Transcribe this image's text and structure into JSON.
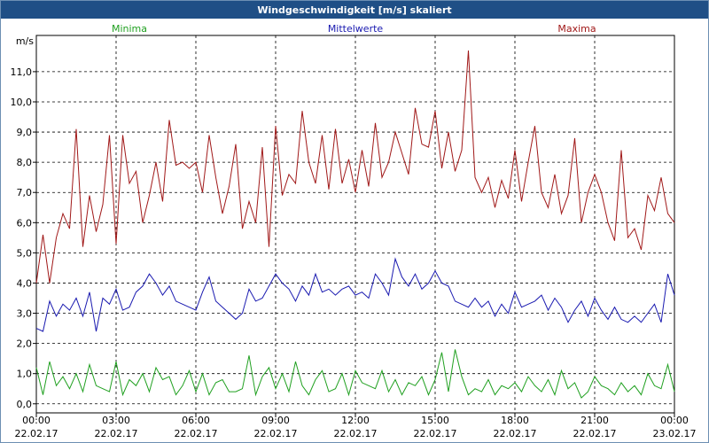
{
  "window": {
    "title": "Windgeschwindigkeit [m/s] skaliert"
  },
  "colors": {
    "minima": "#20a020",
    "mittelwerte": "#1a1ab0",
    "maxima": "#a01818",
    "titlebar": "#1f4f86"
  },
  "chart_data": {
    "type": "line",
    "title": "Windgeschwindigkeit [m/s] skaliert",
    "ylabel": "m/s",
    "ylim": [
      -0.3,
      12.2
    ],
    "yticks": [
      "0,0",
      "1,0",
      "2,0",
      "3,0",
      "4,0",
      "5,0",
      "6,0",
      "7,0",
      "8,0",
      "9,0",
      "10,0",
      "11,0"
    ],
    "xlim_hours": [
      0,
      24
    ],
    "xticks": [
      {
        "time": "00:00",
        "date": "22.02.17"
      },
      {
        "time": "03:00",
        "date": "22.02.17"
      },
      {
        "time": "06:00",
        "date": "22.02.17"
      },
      {
        "time": "09:00",
        "date": "22.02.17"
      },
      {
        "time": "12:00",
        "date": "22.02.17"
      },
      {
        "time": "15:00",
        "date": "22.02.17"
      },
      {
        "time": "18:00",
        "date": "22.02.17"
      },
      {
        "time": "21:00",
        "date": "22.02.17"
      },
      {
        "time": "00:00",
        "date": "23.02.17"
      }
    ],
    "grid": true,
    "legend_position": "top",
    "series": [
      {
        "name": "Minima",
        "color": "#20a020",
        "x": [
          0,
          0.25,
          0.5,
          0.75,
          1,
          1.25,
          1.5,
          1.75,
          2,
          2.25,
          2.5,
          2.75,
          3,
          3.25,
          3.5,
          3.75,
          4,
          4.25,
          4.5,
          4.75,
          5,
          5.25,
          5.5,
          5.75,
          6,
          6.25,
          6.5,
          6.75,
          7,
          7.25,
          7.5,
          7.75,
          8,
          8.25,
          8.5,
          8.75,
          9,
          9.25,
          9.5,
          9.75,
          10,
          10.25,
          10.5,
          10.75,
          11,
          11.25,
          11.5,
          11.75,
          12,
          12.25,
          12.5,
          12.75,
          13,
          13.25,
          13.5,
          13.75,
          14,
          14.25,
          14.5,
          14.75,
          15,
          15.25,
          15.5,
          15.75,
          16,
          16.25,
          16.5,
          16.75,
          17,
          17.25,
          17.5,
          17.75,
          18,
          18.25,
          18.5,
          18.75,
          19,
          19.25,
          19.5,
          19.75,
          20,
          20.25,
          20.5,
          20.75,
          21,
          21.25,
          21.5,
          21.75,
          22,
          22.25,
          22.5,
          22.75,
          23,
          23.25,
          23.5,
          23.75,
          24
        ],
        "values": [
          1.2,
          0.3,
          1.4,
          0.6,
          0.9,
          0.5,
          1.0,
          0.4,
          1.3,
          0.6,
          0.5,
          0.4,
          1.4,
          0.3,
          0.8,
          0.6,
          1.0,
          0.4,
          1.2,
          0.8,
          0.9,
          0.3,
          0.6,
          1.1,
          0.4,
          1.0,
          0.3,
          0.7,
          0.8,
          0.4,
          0.4,
          0.5,
          1.6,
          0.3,
          0.9,
          1.2,
          0.5,
          1.0,
          0.4,
          1.4,
          0.6,
          0.3,
          0.8,
          1.1,
          0.4,
          0.5,
          1.0,
          0.3,
          1.1,
          0.7,
          0.6,
          0.5,
          1.1,
          0.4,
          0.8,
          0.3,
          0.7,
          0.6,
          0.9,
          0.3,
          0.8,
          1.7,
          0.4,
          1.8,
          0.9,
          0.3,
          0.5,
          0.4,
          0.8,
          0.3,
          0.6,
          0.5,
          0.7,
          0.4,
          0.9,
          0.6,
          0.4,
          0.8,
          0.3,
          1.1,
          0.5,
          0.7,
          0.2,
          0.4,
          0.9,
          0.6,
          0.5,
          0.3,
          0.7,
          0.4,
          0.6,
          0.3,
          1.0,
          0.6,
          0.5,
          1.3,
          0.4
        ],
        "label_position": "left"
      },
      {
        "name": "Mittelwerte",
        "color": "#1a1ab0",
        "x": [
          0,
          0.25,
          0.5,
          0.75,
          1,
          1.25,
          1.5,
          1.75,
          2,
          2.25,
          2.5,
          2.75,
          3,
          3.25,
          3.5,
          3.75,
          4,
          4.25,
          4.5,
          4.75,
          5,
          5.25,
          5.5,
          5.75,
          6,
          6.25,
          6.5,
          6.75,
          7,
          7.25,
          7.5,
          7.75,
          8,
          8.25,
          8.5,
          8.75,
          9,
          9.25,
          9.5,
          9.75,
          10,
          10.25,
          10.5,
          10.75,
          11,
          11.25,
          11.5,
          11.75,
          12,
          12.25,
          12.5,
          12.75,
          13,
          13.25,
          13.5,
          13.75,
          14,
          14.25,
          14.5,
          14.75,
          15,
          15.25,
          15.5,
          15.75,
          16,
          16.25,
          16.5,
          16.75,
          17,
          17.25,
          17.5,
          17.75,
          18,
          18.25,
          18.5,
          18.75,
          19,
          19.25,
          19.5,
          19.75,
          20,
          20.25,
          20.5,
          20.75,
          21,
          21.25,
          21.5,
          21.75,
          22,
          22.25,
          22.5,
          22.75,
          23,
          23.25,
          23.5,
          23.75,
          24
        ],
        "values": [
          2.5,
          2.4,
          3.4,
          2.9,
          3.3,
          3.1,
          3.5,
          2.9,
          3.7,
          2.4,
          3.5,
          3.3,
          3.8,
          3.1,
          3.2,
          3.7,
          3.9,
          4.3,
          4.0,
          3.6,
          3.9,
          3.4,
          3.3,
          3.2,
          3.1,
          3.7,
          4.2,
          3.4,
          3.2,
          3.0,
          2.8,
          3.0,
          3.8,
          3.4,
          3.5,
          3.9,
          4.3,
          4.0,
          3.8,
          3.4,
          3.9,
          3.6,
          4.3,
          3.7,
          3.8,
          3.6,
          3.8,
          3.9,
          3.6,
          3.7,
          3.5,
          4.3,
          4.0,
          3.6,
          4.8,
          4.2,
          3.9,
          4.3,
          3.8,
          4.0,
          4.4,
          4.0,
          3.9,
          3.4,
          3.3,
          3.2,
          3.5,
          3.2,
          3.4,
          2.9,
          3.3,
          3.0,
          3.7,
          3.2,
          3.3,
          3.4,
          3.6,
          3.1,
          3.5,
          3.2,
          2.7,
          3.1,
          3.4,
          2.9,
          3.5,
          3.1,
          2.8,
          3.2,
          2.8,
          2.7,
          2.9,
          2.7,
          3.0,
          3.3,
          2.7,
          4.3,
          3.6
        ],
        "label_position": "center"
      },
      {
        "name": "Maxima",
        "color": "#a01818",
        "x": [
          0,
          0.25,
          0.5,
          0.75,
          1,
          1.25,
          1.5,
          1.75,
          2,
          2.25,
          2.5,
          2.75,
          3,
          3.25,
          3.5,
          3.75,
          4,
          4.25,
          4.5,
          4.75,
          5,
          5.25,
          5.5,
          5.75,
          6,
          6.25,
          6.5,
          6.75,
          7,
          7.25,
          7.5,
          7.75,
          8,
          8.25,
          8.5,
          8.75,
          9,
          9.25,
          9.5,
          9.75,
          10,
          10.25,
          10.5,
          10.75,
          11,
          11.25,
          11.5,
          11.75,
          12,
          12.25,
          12.5,
          12.75,
          13,
          13.25,
          13.5,
          13.75,
          14,
          14.25,
          14.5,
          14.75,
          15,
          15.25,
          15.5,
          15.75,
          16,
          16.25,
          16.5,
          16.75,
          17,
          17.25,
          17.5,
          17.75,
          18,
          18.25,
          18.5,
          18.75,
          19,
          19.25,
          19.5,
          19.75,
          20,
          20.25,
          20.5,
          20.75,
          21,
          21.25,
          21.5,
          21.75,
          22,
          22.25,
          22.5,
          22.75,
          23,
          23.25,
          23.5,
          23.75,
          24
        ],
        "values": [
          4.0,
          5.6,
          4.0,
          5.5,
          6.3,
          5.8,
          9.1,
          5.2,
          6.9,
          5.7,
          6.6,
          8.9,
          5.3,
          8.9,
          7.3,
          7.7,
          6.0,
          6.9,
          8.0,
          6.7,
          9.4,
          7.9,
          8.0,
          7.8,
          8.0,
          7.0,
          8.9,
          7.5,
          6.3,
          7.2,
          8.6,
          5.8,
          6.7,
          6.0,
          8.5,
          5.2,
          9.2,
          6.9,
          7.6,
          7.3,
          9.7,
          8.0,
          7.3,
          8.9,
          7.1,
          9.1,
          7.3,
          8.1,
          7.0,
          8.4,
          7.2,
          9.3,
          7.5,
          8.0,
          9.0,
          8.3,
          7.6,
          9.8,
          8.6,
          8.5,
          9.7,
          7.8,
          9.0,
          7.7,
          8.4,
          11.7,
          7.5,
          7.0,
          7.5,
          6.5,
          7.4,
          6.8,
          8.4,
          6.7,
          8.0,
          9.2,
          7.0,
          6.5,
          7.6,
          6.3,
          6.9,
          8.8,
          6.0,
          7.0,
          7.6,
          7.0,
          6.0,
          5.4,
          8.4,
          5.5,
          5.8,
          5.1,
          6.9,
          6.4,
          7.5,
          6.3,
          6.0
        ],
        "label_position": "right"
      }
    ]
  }
}
